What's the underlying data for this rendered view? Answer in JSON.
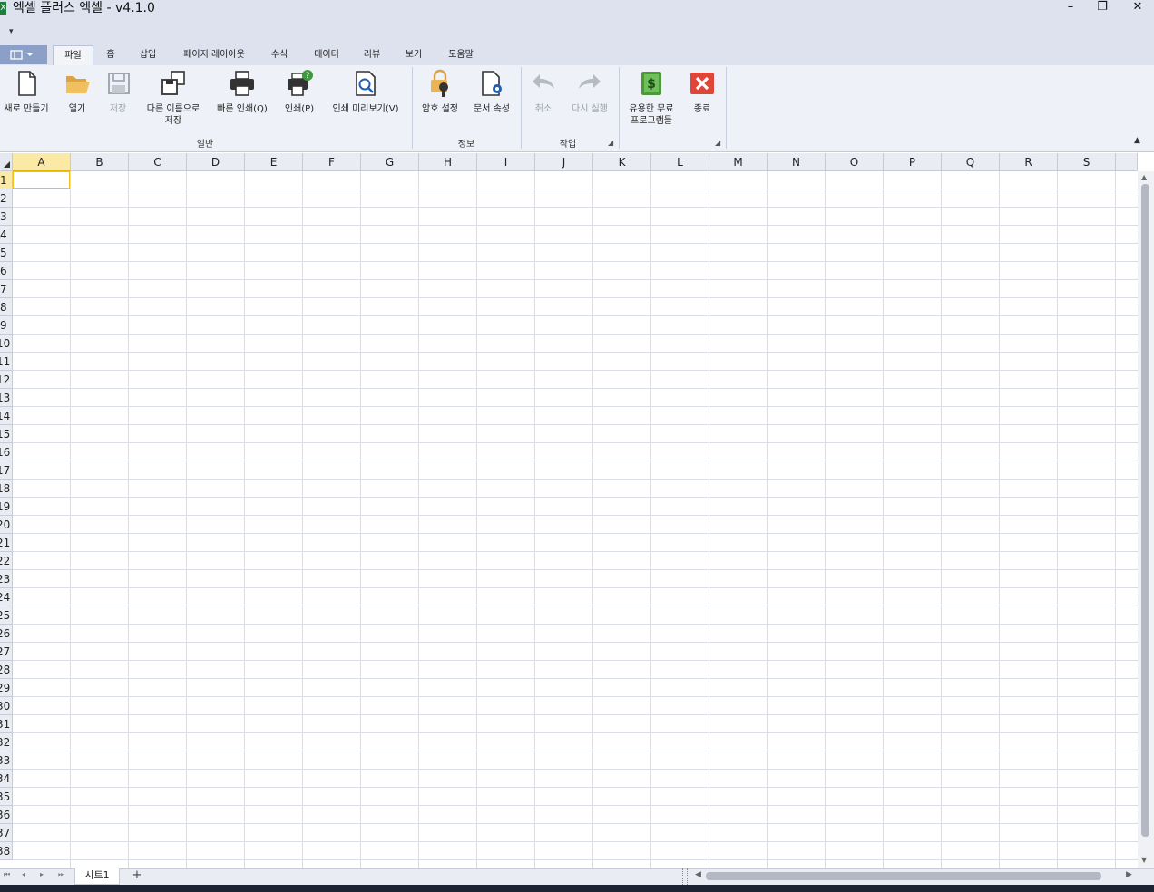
{
  "window": {
    "title": "엑셀 플러스 엑셀 - v4.1.0",
    "controls": {
      "minimize": "–",
      "restore": "❐",
      "close": "✕"
    }
  },
  "qat": {
    "dropdown": "▾"
  },
  "tabs": [
    {
      "label": "파일",
      "active": true
    },
    {
      "label": "홈",
      "active": false
    },
    {
      "label": "삽입",
      "active": false
    },
    {
      "label": "페이지 레이아웃",
      "active": false
    },
    {
      "label": "수식",
      "active": false
    },
    {
      "label": "데이터",
      "active": false
    },
    {
      "label": "리뷰",
      "active": false
    },
    {
      "label": "보기",
      "active": false
    },
    {
      "label": "도움말",
      "active": false
    }
  ],
  "ribbon": {
    "groups": {
      "general": "일반",
      "info": "정보",
      "work": "작업"
    },
    "buttons": {
      "new": "새로 만들기",
      "open": "열기",
      "save": "저장",
      "save_as_1": "다른 이름으로",
      "save_as_2": "저장",
      "quick_print": "빠른 인쇄(Q)",
      "print": "인쇄(P)",
      "print_preview": "인쇄 미리보기(V)",
      "password": "암호 설정",
      "doc_props": "문서 속성",
      "undo": "취소",
      "redo": "다시 실행",
      "free_programs_1": "유용한 무료",
      "free_programs_2": "프로그램들",
      "exit": "종료"
    },
    "collapse_icon": "▲"
  },
  "grid": {
    "columns": [
      "A",
      "B",
      "C",
      "D",
      "E",
      "F",
      "G",
      "H",
      "I",
      "J",
      "K",
      "L",
      "M",
      "N",
      "O",
      "P",
      "Q",
      "R",
      "S"
    ],
    "rows": [
      "1",
      "2",
      "3",
      "4",
      "5",
      "6",
      "7",
      "8",
      "9",
      "10",
      "11",
      "12",
      "13",
      "14",
      "15",
      "16",
      "17",
      "18",
      "19",
      "20",
      "21",
      "22",
      "23",
      "24",
      "25",
      "26",
      "27",
      "28",
      "29",
      "30",
      "31",
      "32",
      "33",
      "34",
      "35",
      "36",
      "37",
      "38"
    ],
    "selected_cell": "A1"
  },
  "sheets": {
    "tabs": [
      "시트1"
    ],
    "add": "+",
    "nav": [
      "⏮",
      "◂",
      "▸",
      "⏭"
    ]
  },
  "colors": {
    "chrome": "#dde2ee",
    "ribbon": "#eef1f7",
    "selection": "#f0c020",
    "exit_red": "#e0453a",
    "money_green": "#4a9a3c"
  }
}
